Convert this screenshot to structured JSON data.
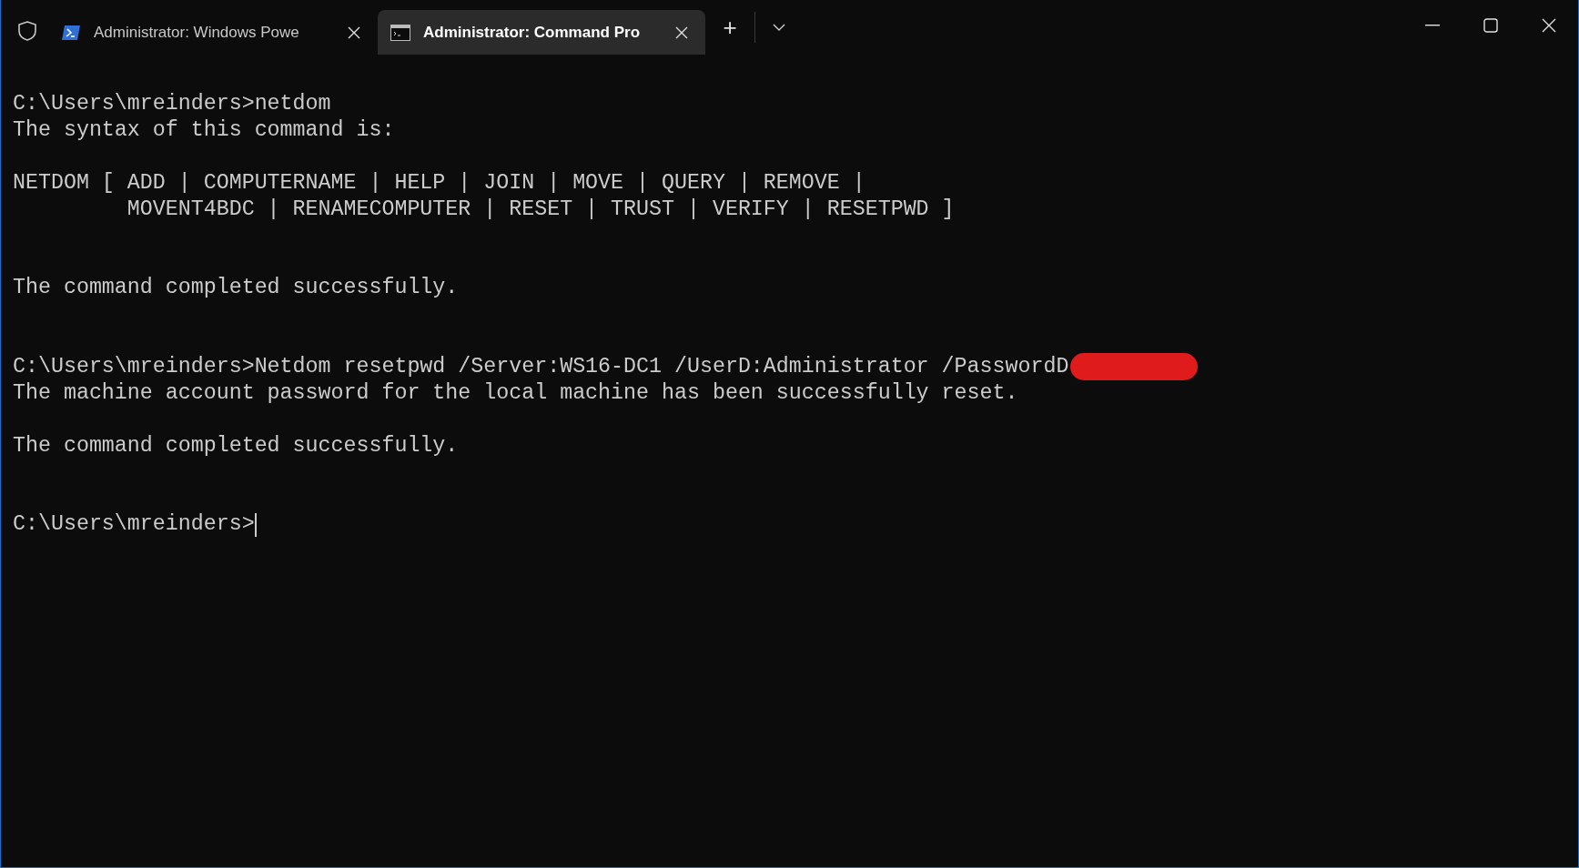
{
  "tabs": [
    {
      "title": "Administrator: Windows Powe",
      "kind": "powershell",
      "selected": false
    },
    {
      "title": "Administrator: Command Pro",
      "kind": "cmd",
      "selected": true
    }
  ],
  "new_tab": "+",
  "terminal": {
    "lines": [
      {
        "kind": "text",
        "text": "C:\\Users\\mreinders>netdom"
      },
      {
        "kind": "text",
        "text": "The syntax of this command is:"
      },
      {
        "kind": "blank"
      },
      {
        "kind": "text",
        "text": "NETDOM [ ADD | COMPUTERNAME | HELP | JOIN | MOVE | QUERY | REMOVE |"
      },
      {
        "kind": "text",
        "text": "         MOVENT4BDC | RENAMECOMPUTER | RESET | TRUST | VERIFY | RESETPWD ]"
      },
      {
        "kind": "blank"
      },
      {
        "kind": "blank"
      },
      {
        "kind": "text",
        "text": "The command completed successfully."
      },
      {
        "kind": "blank"
      },
      {
        "kind": "blank"
      },
      {
        "kind": "text",
        "text": "C:\\Users\\mreinders>Netdom resetpwd /Server:WS16-DC1 /UserD:Administrator /PasswordD",
        "redacted": true
      },
      {
        "kind": "text",
        "text": "The machine account password for the local machine has been successfully reset."
      },
      {
        "kind": "blank"
      },
      {
        "kind": "text",
        "text": "The command completed successfully."
      },
      {
        "kind": "blank"
      },
      {
        "kind": "blank"
      },
      {
        "kind": "text",
        "text": "C:\\Users\\mreinders>",
        "cursor": true
      }
    ]
  }
}
